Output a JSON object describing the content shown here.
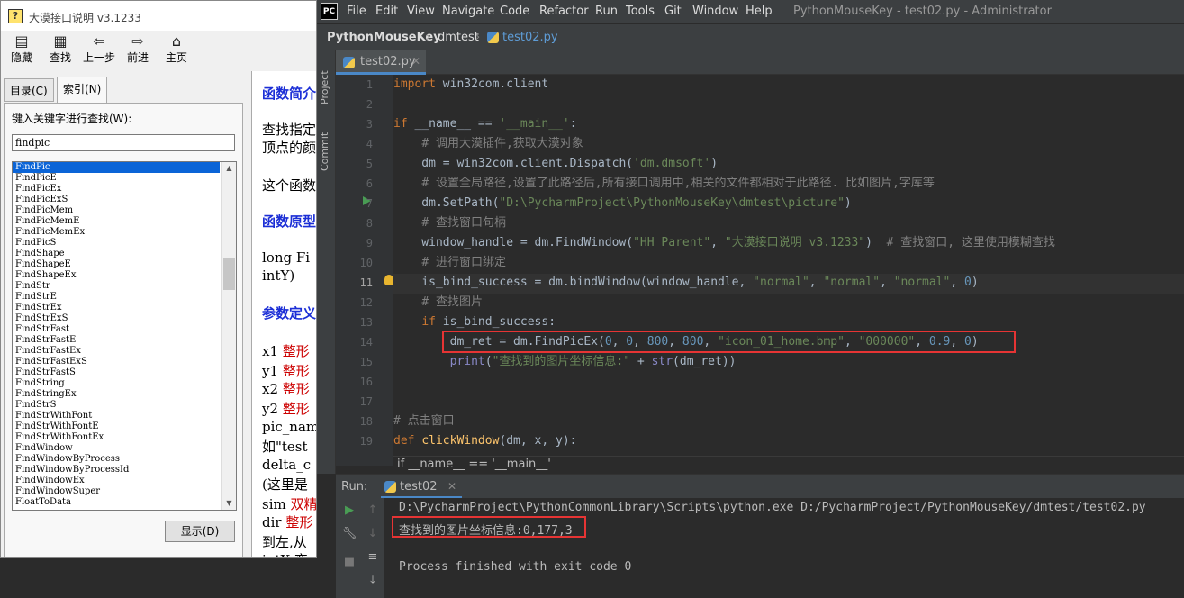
{
  "help": {
    "title": "大漠接口说明 v3.1233",
    "toolbar": [
      {
        "icon": "hide-icon",
        "glyph": "▤",
        "label": "隐藏"
      },
      {
        "icon": "find-icon",
        "glyph": "▦",
        "label": "查找"
      },
      {
        "icon": "back-icon",
        "glyph": "⇦",
        "label": "上一步"
      },
      {
        "icon": "forward-icon",
        "glyph": "⇨",
        "label": "前进"
      },
      {
        "icon": "home-icon",
        "glyph": "⌂",
        "label": "主页"
      }
    ],
    "tabs": [
      {
        "label": "目录(C)"
      },
      {
        "label": "索引(N)"
      }
    ],
    "keyword_label": "键入关键字进行查找(W):",
    "keyword_value": "findpic",
    "keywords": [
      "FindPic",
      "FindPicE",
      "FindPicEx",
      "FindPicExS",
      "FindPicMem",
      "FindPicMemE",
      "FindPicMemEx",
      "FindPicS",
      "FindShape",
      "FindShapeE",
      "FindShapeEx",
      "FindStr",
      "FindStrE",
      "FindStrEx",
      "FindStrExS",
      "FindStrFast",
      "FindStrFastE",
      "FindStrFastEx",
      "FindStrFastExS",
      "FindStrFastS",
      "FindString",
      "FindStringEx",
      "FindStrS",
      "FindStrWithFont",
      "FindStrWithFontE",
      "FindStrWithFontEx",
      "FindWindow",
      "FindWindowByProcess",
      "FindWindowByProcessId",
      "FindWindowEx",
      "FindWindowSuper",
      "FloatToData"
    ],
    "selected_keyword": "FindPic",
    "show_button": "显示(D)",
    "content": [
      {
        "text": "函数简介",
        "style": "hd"
      },
      {
        "text": "查找指定",
        "style": ""
      },
      {
        "text": "顶点的颜",
        "style": ""
      },
      {
        "text": "这个函数",
        "style": ""
      },
      {
        "text": "函数原型",
        "style": "hd"
      },
      {
        "text": "long Fi",
        "style": ""
      },
      {
        "text": "intY)",
        "style": ""
      },
      {
        "text": "参数定义",
        "style": "hd"
      },
      {
        "text": "x1 整形",
        "style": "mix"
      },
      {
        "text": "y1 整形",
        "style": "mix"
      },
      {
        "text": "x2 整形",
        "style": "mix"
      },
      {
        "text": "y2 整形",
        "style": "mix"
      },
      {
        "text": "pic_nam",
        "style": ""
      },
      {
        "text": "如\"test",
        "style": ""
      },
      {
        "text": "delta_c",
        "style": ""
      },
      {
        "text": "(这里是",
        "style": ""
      },
      {
        "text": "sim 双精",
        "style": "mix"
      },
      {
        "text": "dir 整形",
        "style": "mix"
      },
      {
        "text": "到左,从",
        "style": ""
      },
      {
        "text": "intX 变",
        "style": ""
      }
    ]
  },
  "ide": {
    "app_icon": "PC",
    "menu": [
      "File",
      "Edit",
      "View",
      "Navigate",
      "Code",
      "Refactor",
      "Run",
      "Tools",
      "Git",
      "Window",
      "Help"
    ],
    "window_title": "PythonMouseKey - test02.py - Administrator",
    "breadcrumb": [
      "PythonMouseKey",
      "dmtest",
      "test02.py"
    ],
    "side_tools": [
      "Project",
      "Commit"
    ],
    "file_tab": "test02.py",
    "current_line": 11,
    "line_numbers": [
      "1",
      "2",
      "3",
      "4",
      "5",
      "6",
      "7",
      "8",
      "9",
      "10",
      "11",
      "12",
      "13",
      "14",
      "15",
      "16",
      "17",
      "18",
      "19"
    ],
    "fold_hint": "if __name__ == '__main__'",
    "run_label": "Run:",
    "run_tab": "test02",
    "console": [
      "D:\\PycharmProject\\PythonCommonLibrary\\Scripts\\python.exe D:/PycharmProject/PythonMouseKey/dmtest/test02.py",
      "查找到的图片坐标信息:0,177,3",
      "",
      "Process finished with exit code 0"
    ],
    "code": [
      [
        [
          "kw",
          "import "
        ],
        [
          "",
          "win32com.client"
        ]
      ],
      [],
      [
        [
          "kw",
          "if "
        ],
        [
          "",
          "__name__ == "
        ],
        [
          "st",
          "'__main__'"
        ],
        [
          "",
          ":"
        ]
      ],
      [
        [
          "",
          "    "
        ],
        [
          "cm",
          "# 调用大漠插件,获取大漠对象"
        ]
      ],
      [
        [
          "",
          "    dm = win32com.client.Dispatch("
        ],
        [
          "st",
          "'dm.dmsoft'"
        ],
        [
          "",
          ")"
        ]
      ],
      [
        [
          "",
          "    "
        ],
        [
          "cm",
          "# 设置全局路径,设置了此路径后,所有接口调用中,相关的文件都相对于此路径. 比如图片,字库等"
        ]
      ],
      [
        [
          "",
          "    dm.SetPath("
        ],
        [
          "st",
          "\"D:\\PycharmProject\\PythonMouseKey\\dmtest\\picture\""
        ],
        [
          "",
          ")"
        ]
      ],
      [
        [
          "",
          "    "
        ],
        [
          "cm",
          "# 查找窗口句柄"
        ]
      ],
      [
        [
          "",
          "    window_handle = dm.FindWindow("
        ],
        [
          "st",
          "\"HH Parent\""
        ],
        [
          "",
          ", "
        ],
        [
          "st",
          "\"大漠接口说明 v3.1233\""
        ],
        [
          "",
          ")  "
        ],
        [
          "cm",
          "# 查找窗口, 这里使用模糊查找"
        ]
      ],
      [
        [
          "",
          "    "
        ],
        [
          "cm",
          "# 进行窗口绑定"
        ]
      ],
      [
        [
          "",
          "    is_bind_success = dm.bindWindow(window_handle, "
        ],
        [
          "st",
          "\"normal\""
        ],
        [
          "",
          ", "
        ],
        [
          "st",
          "\"normal\""
        ],
        [
          "",
          ", "
        ],
        [
          "st",
          "\"normal\""
        ],
        [
          "",
          ", "
        ],
        [
          "num",
          "0"
        ],
        [
          "",
          ")"
        ]
      ],
      [
        [
          "",
          "    "
        ],
        [
          "cm",
          "# 查找图片"
        ]
      ],
      [
        [
          "",
          "    "
        ],
        [
          "kw",
          "if "
        ],
        [
          "",
          "is_bind_success:"
        ]
      ],
      [
        [
          "",
          "        dm_ret = dm.FindPicEx("
        ],
        [
          "num",
          "0"
        ],
        [
          "",
          ", "
        ],
        [
          "num",
          "0"
        ],
        [
          "",
          ", "
        ],
        [
          "num",
          "800"
        ],
        [
          "",
          ", "
        ],
        [
          "num",
          "800"
        ],
        [
          "",
          ", "
        ],
        [
          "st",
          "\"icon_01_home.bmp\""
        ],
        [
          "",
          ", "
        ],
        [
          "st",
          "\"000000\""
        ],
        [
          "",
          ", "
        ],
        [
          "num",
          "0.9"
        ],
        [
          "",
          ", "
        ],
        [
          "num",
          "0"
        ],
        [
          "",
          ")"
        ]
      ],
      [
        [
          "",
          "        "
        ],
        [
          "bi",
          "print"
        ],
        [
          "",
          "("
        ],
        [
          "st",
          "\"查找到的图片坐标信息:\""
        ],
        [
          "",
          " + "
        ],
        [
          "bi",
          "str"
        ],
        [
          "",
          "(dm_ret))"
        ]
      ],
      [],
      [],
      [
        [
          "cm",
          "# 点击窗口"
        ]
      ],
      [
        [
          "kw",
          "def "
        ],
        [
          "fn",
          "clickWindow"
        ],
        [
          "",
          "(dm, x, y):"
        ]
      ]
    ]
  }
}
